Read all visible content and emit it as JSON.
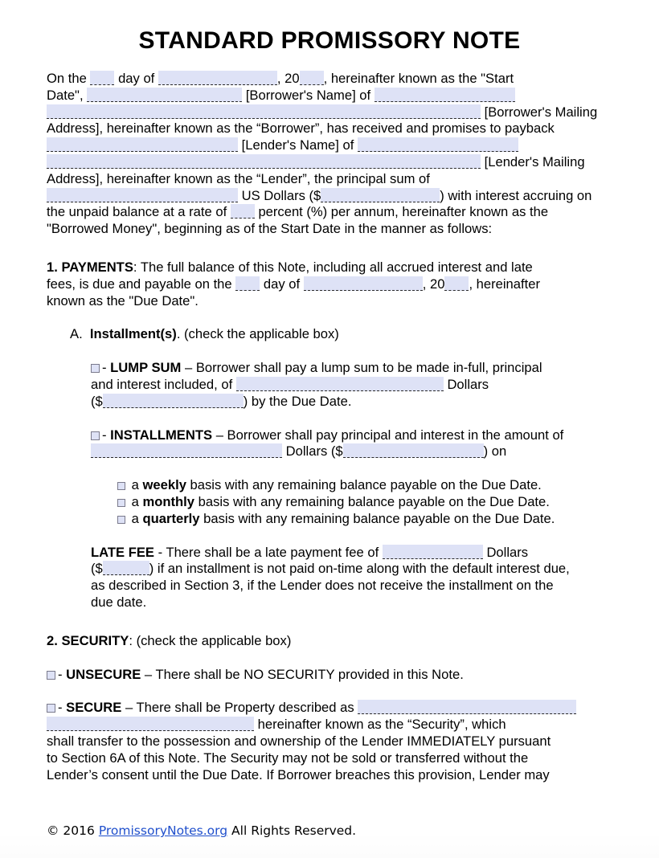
{
  "document": {
    "title": "STANDARD PROMISSORY NOTE"
  },
  "intro": {
    "l1_a": "On the",
    "l1_b": "day of",
    "l1_c": ", 20",
    "l1_d": ", hereinafter known as the \"Start",
    "l2_a": "Date\",",
    "l2_b": "[Borrower's Name] of",
    "l3_b": "[Borrower's Mailing",
    "l4": "Address], hereinafter known as the “Borrower”, has received and promises to payback",
    "l5_b": "[Lender's Name] of",
    "l6_b": "[Lender's Mailing",
    "l7": "Address], hereinafter known as the “Lender”, the principal sum of",
    "l8_b": "US Dollars ($",
    "l8_c": ") with interest accruing on",
    "l9_a": "the unpaid balance at a rate of",
    "l9_b": "percent (%) per annum, hereinafter known as the",
    "l10": "\"Borrowed Money\", beginning as of the Start Date in the manner as follows:"
  },
  "payments": {
    "heading_number": "1. PAYMENTS",
    "heading_rest": ": The full balance of this Note, including all accrued interest and late",
    "l2_a": "fees, is due and payable on the",
    "l2_b": "day of",
    "l2_c": ", 20",
    "l2_d": ", hereinafter",
    "l3": "known as the \"Due Date\".",
    "item_a_letter": "A.",
    "item_a_bold": "Installment(s)",
    "item_a_rest": ". (check the applicable box)"
  },
  "lump_sum": {
    "dash": "-",
    "label": "LUMP SUM",
    "text_1": "– Borrower shall pay a lump sum to be made in-full, principal",
    "text_2": "and interest included, of",
    "text_3": "Dollars",
    "text_4": "($",
    "text_5": ") by the Due Date."
  },
  "installments": {
    "dash": "-",
    "label": "INSTALLMENTS",
    "text_1": "– Borrower shall pay principal and interest in the amount of",
    "text_2": "Dollars ($",
    "text_3": ") on",
    "options": [
      {
        "prefix": "a",
        "bold": "weekly",
        "suffix": "basis with any remaining balance payable on the Due Date."
      },
      {
        "prefix": "a",
        "bold": "monthly",
        "suffix": "basis with any remaining balance payable on the Due Date."
      },
      {
        "prefix": "a",
        "bold": "quarterly",
        "suffix": "basis with any remaining balance payable on the Due Date."
      }
    ]
  },
  "late_fee": {
    "label": "LATE FEE",
    "text_1": "- There shall be a late payment fee of",
    "text_2": "Dollars",
    "text_3": "($",
    "text_4": ") if an installment is not paid on-time along with the default interest due,",
    "text_5": "as described in Section 3, if the Lender does not receive the installment on the",
    "text_6": "due date."
  },
  "security": {
    "heading_number": "2. SECURITY",
    "heading_rest": ": (check the applicable box)",
    "unsecure": {
      "dash": "-",
      "label": "UNSECURE",
      "text": "– There shall be NO SECURITY provided in this Note."
    },
    "secure": {
      "dash": "-",
      "label": "SECURE",
      "text_1": "– There shall be Property described as",
      "text_2": "hereinafter known as the “Security”, which",
      "text_3": "shall transfer to the possession and ownership of the Lender IMMEDIATELY pursuant",
      "text_4": "to Section 6A of this Note. The Security may not be sold or transferred without the",
      "text_5": "Lender’s consent until the Due Date. If Borrower breaches this provision, Lender may"
    }
  },
  "footer": {
    "copyright": "© 2016",
    "link_text": "PromissoryNotes.org",
    "rights": "All Rights Reserved."
  },
  "colors": {
    "field_fill": "#dee2f6",
    "link": "#1f4fcc",
    "text": "#000000"
  }
}
